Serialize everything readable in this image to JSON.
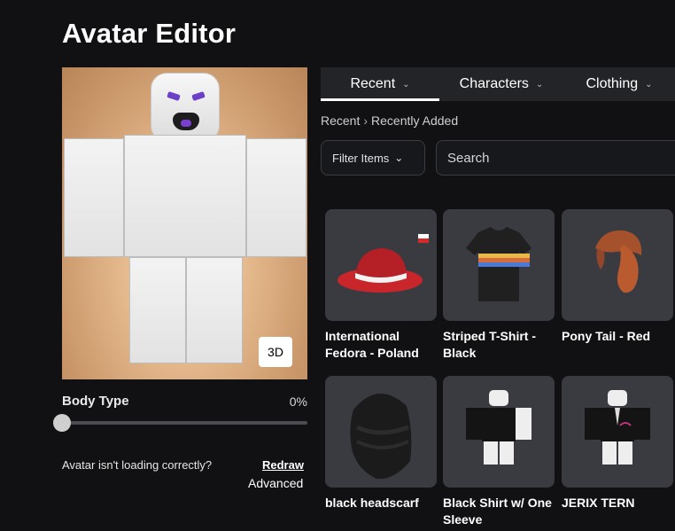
{
  "page": {
    "title": "Avatar Editor"
  },
  "preview": {
    "view_toggle": "3D"
  },
  "body_type": {
    "label": "Body Type",
    "value": "0%",
    "level": 0
  },
  "loading": {
    "message": "Avatar isn't loading correctly?",
    "redraw": "Redraw",
    "advanced": "Advanced"
  },
  "tabs": [
    {
      "label": "Recent",
      "active": true
    },
    {
      "label": "Characters",
      "active": false
    },
    {
      "label": "Clothing",
      "active": false
    }
  ],
  "breadcrumb": {
    "root": "Recent",
    "current": "Recently Added"
  },
  "filter": {
    "label": "Filter Items"
  },
  "search": {
    "placeholder": "Search"
  },
  "items": [
    {
      "name": "International Fedora - Poland"
    },
    {
      "name": "Striped T-Shirt - Black"
    },
    {
      "name": "Pony Tail - Red"
    },
    {
      "name": "black headscarf"
    },
    {
      "name": "Black Shirt w/ One Sleeve"
    },
    {
      "name": "JERIX TERN"
    }
  ]
}
